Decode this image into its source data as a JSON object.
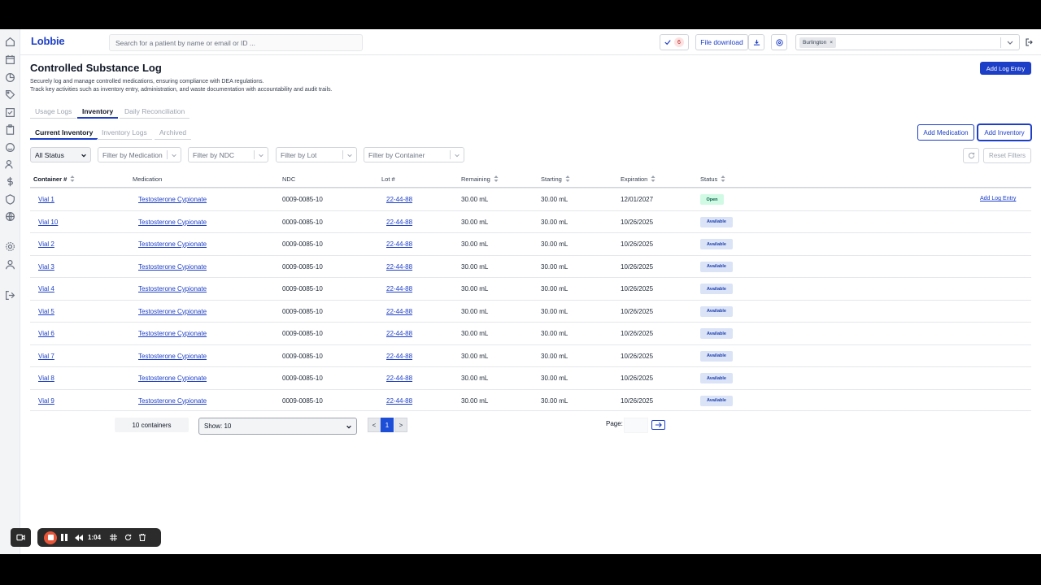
{
  "header": {
    "logo": "Lobbie",
    "search_placeholder": "Search for a patient by name or email or ID ...",
    "tasks_count": "6",
    "file_download_label": "File download",
    "location_chip": "Burlington",
    "location_chip_remove": "×"
  },
  "page": {
    "title": "Controlled Substance Log",
    "desc_line1": "Securely log and manage controlled medications, ensuring compliance with DEA regulations.",
    "desc_line2": "Track key activities such as inventory entry, administration, and waste documentation with accountability and audit trails.",
    "add_log_entry_label": "Add Log Entry"
  },
  "tabs": [
    {
      "label": "Usage Logs"
    },
    {
      "label": "Inventory"
    },
    {
      "label": "Daily Reconciliation"
    }
  ],
  "subtabs": [
    {
      "label": "Current Inventory"
    },
    {
      "label": "Inventory Logs"
    },
    {
      "label": "Archived"
    }
  ],
  "actions": {
    "add_medication": "Add Medication",
    "add_inventory": "Add Inventory",
    "reset_filters": "Reset Filters"
  },
  "filters": {
    "status": "All Status",
    "medication": "Filter by Medication",
    "ndc": "Filter by NDC",
    "lot": "Filter by Lot",
    "container": "Filter by Container"
  },
  "table": {
    "columns": [
      "Container #",
      "Medication",
      "NDC",
      "Lot #",
      "Remaining",
      "Starting",
      "Expiration",
      "Status"
    ],
    "row_action": "Add Log Entry",
    "rows": [
      {
        "container": "Vial 1",
        "medication": "Testosterone Cypionate",
        "ndc": "0009-0085-10",
        "lot": "22-44-88",
        "remaining": "30.00 mL",
        "starting": "30.00 mL",
        "expiration": "12/01/2027",
        "status": "Open"
      },
      {
        "container": "Vial 10",
        "medication": "Testosterone Cypionate",
        "ndc": "0009-0085-10",
        "lot": "22-44-88",
        "remaining": "30.00 mL",
        "starting": "30.00 mL",
        "expiration": "10/26/2025",
        "status": "Available"
      },
      {
        "container": "Vial 2",
        "medication": "Testosterone Cypionate",
        "ndc": "0009-0085-10",
        "lot": "22-44-88",
        "remaining": "30.00 mL",
        "starting": "30.00 mL",
        "expiration": "10/26/2025",
        "status": "Available"
      },
      {
        "container": "Vial 3",
        "medication": "Testosterone Cypionate",
        "ndc": "0009-0085-10",
        "lot": "22-44-88",
        "remaining": "30.00 mL",
        "starting": "30.00 mL",
        "expiration": "10/26/2025",
        "status": "Available"
      },
      {
        "container": "Vial 4",
        "medication": "Testosterone Cypionate",
        "ndc": "0009-0085-10",
        "lot": "22-44-88",
        "remaining": "30.00 mL",
        "starting": "30.00 mL",
        "expiration": "10/26/2025",
        "status": "Available"
      },
      {
        "container": "Vial 5",
        "medication": "Testosterone Cypionate",
        "ndc": "0009-0085-10",
        "lot": "22-44-88",
        "remaining": "30.00 mL",
        "starting": "30.00 mL",
        "expiration": "10/26/2025",
        "status": "Available"
      },
      {
        "container": "Vial 6",
        "medication": "Testosterone Cypionate",
        "ndc": "0009-0085-10",
        "lot": "22-44-88",
        "remaining": "30.00 mL",
        "starting": "30.00 mL",
        "expiration": "10/26/2025",
        "status": "Available"
      },
      {
        "container": "Vial 7",
        "medication": "Testosterone Cypionate",
        "ndc": "0009-0085-10",
        "lot": "22-44-88",
        "remaining": "30.00 mL",
        "starting": "30.00 mL",
        "expiration": "10/26/2025",
        "status": "Available"
      },
      {
        "container": "Vial 8",
        "medication": "Testosterone Cypionate",
        "ndc": "0009-0085-10",
        "lot": "22-44-88",
        "remaining": "30.00 mL",
        "starting": "30.00 mL",
        "expiration": "10/26/2025",
        "status": "Available"
      },
      {
        "container": "Vial 9",
        "medication": "Testosterone Cypionate",
        "ndc": "0009-0085-10",
        "lot": "22-44-88",
        "remaining": "30.00 mL",
        "starting": "30.00 mL",
        "expiration": "10/26/2025",
        "status": "Available"
      }
    ]
  },
  "pagination": {
    "count_label": "10 containers",
    "show_label": "Show: 10",
    "prev": "<",
    "current": "1",
    "next": ">",
    "page_label": "Page:"
  },
  "recorder": {
    "time": "1:04"
  },
  "colors": {
    "brand": "#1d3fc7",
    "open_bg": "#d1fae5",
    "available_bg": "#dbe3f7",
    "recorder_stop": "#e8563a"
  },
  "rail_icons": [
    "home-icon",
    "calendar-icon",
    "chart-icon",
    "tag-icon",
    "checklist-icon",
    "clipboard-icon",
    "smile-icon",
    "users-icon",
    "dollar-icon",
    "shield-icon",
    "globe-icon",
    "settings-icon",
    "user-icon",
    "logout-icon"
  ]
}
